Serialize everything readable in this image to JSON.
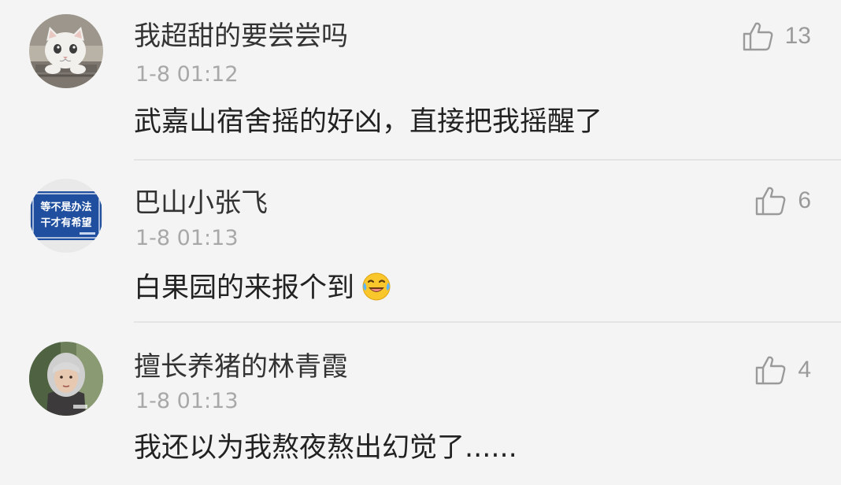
{
  "comments": [
    {
      "username": "我超甜的要尝尝吗",
      "time": "1-8 01:12",
      "text": "武嘉山宿舍摇的好凶，直接把我摇醒了",
      "likes": "13",
      "avatar_icon": "white-cat-avatar"
    },
    {
      "username": "巴山小张飞",
      "time": "1-8 01:13",
      "text": "白果园的来报个到",
      "emoji": "laughing-crying-emoji",
      "likes": "6",
      "avatar_icon": "blue-sign-avatar",
      "avatar_sign_lines": [
        "等不是办法",
        "干才有希望"
      ]
    },
    {
      "username": "擅长养猪的林青霞",
      "time": "1-8 01:13",
      "text": "我还以为我熬夜熬出幻觉了......",
      "likes": "4",
      "avatar_icon": "woman-portrait-avatar"
    }
  ],
  "colors": {
    "background": "#f4f4f4",
    "text_primary": "#222222",
    "text_secondary": "#a8a8a8",
    "sign_blue": "#1f4f9e"
  }
}
